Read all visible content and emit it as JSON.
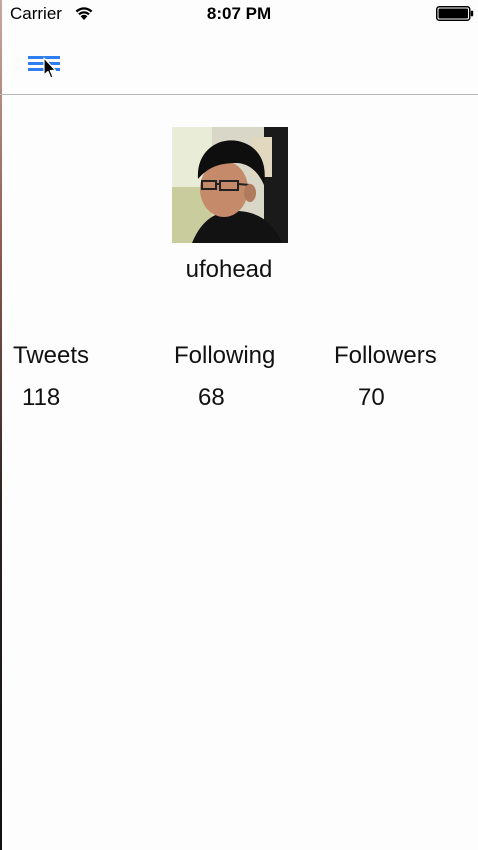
{
  "status_bar": {
    "carrier": "Carrier",
    "time": "8:07 PM",
    "wifi_icon": "wifi-icon",
    "battery_icon": "battery-icon"
  },
  "nav_bar": {
    "menu_icon": "hamburger-menu-icon",
    "accent_color": "#2f7ef0"
  },
  "profile": {
    "avatar_icon": "profile-photo",
    "username": "ufohead"
  },
  "stats": {
    "tweets": {
      "label": "Tweets",
      "value": "118"
    },
    "following": {
      "label": "Following",
      "value": "68"
    },
    "followers": {
      "label": "Followers",
      "value": "70"
    }
  }
}
